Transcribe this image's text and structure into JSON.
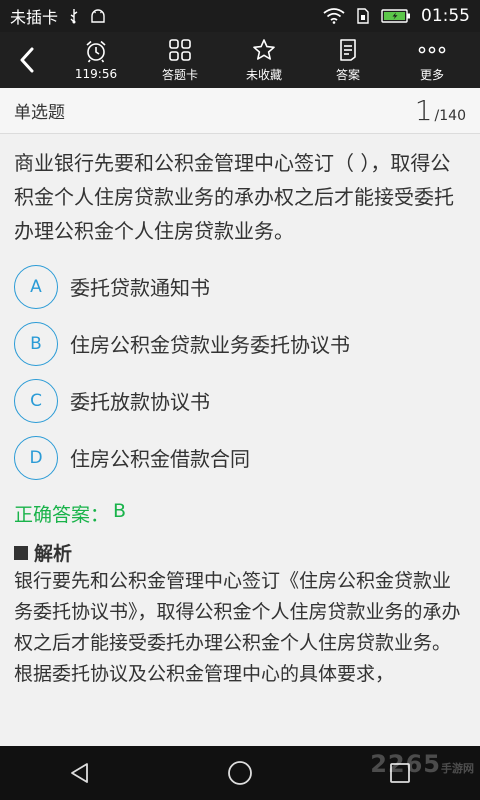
{
  "status_bar": {
    "carrier": "未插卡",
    "time": "01:55"
  },
  "toolbar": {
    "items": [
      {
        "label": "119:56",
        "icon": "alarm-clock-icon"
      },
      {
        "label": "答题卡",
        "icon": "grid-icon"
      },
      {
        "label": "未收藏",
        "icon": "star-icon"
      },
      {
        "label": "答案",
        "icon": "document-icon"
      },
      {
        "label": "更多",
        "icon": "more-icon"
      }
    ]
  },
  "question_header": {
    "type": "单选题",
    "current": "1",
    "total": "/140"
  },
  "question": {
    "text": "商业银行先要和公积金管理中心签订（ ），取得公积金个人住房贷款业务的承办权之后才能接受委托办理公积金个人住房贷款业务。",
    "options": [
      {
        "letter": "A",
        "text": "委托贷款通知书"
      },
      {
        "letter": "B",
        "text": "住房公积金贷款业务委托协议书"
      },
      {
        "letter": "C",
        "text": "委托放款协议书"
      },
      {
        "letter": "D",
        "text": "住房公积金借款合同"
      }
    ],
    "answer_label": "正确答案：",
    "answer_value": "B"
  },
  "analysis": {
    "title": "解析",
    "text": "银行要先和公积金管理中心签订《住房公积金贷款业务委托协议书》，取得公积金个人住房贷款业务的承办权之后才能接受委托办理公积金个人住房贷款业务。根据委托协议及公积金管理中心的具体要求，"
  },
  "watermark": {
    "text": "2265",
    "sub": "手游网"
  },
  "colors": {
    "accent": "#2a9bd6",
    "correct": "#19b34a",
    "toolbar_bg": "#202020"
  }
}
